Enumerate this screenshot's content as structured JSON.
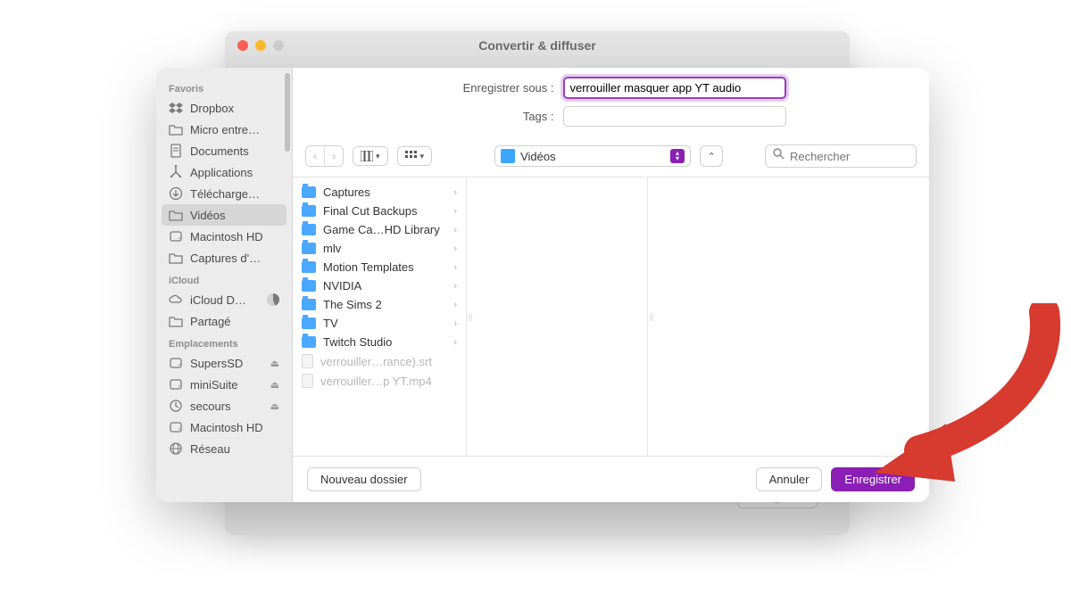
{
  "backdrop": {
    "title": "Convertir & diffuser",
    "button": "Enregistrer"
  },
  "form": {
    "save_as_label": "Enregistrer sous :",
    "save_as_value": "verrouiller masquer app YT audio",
    "tags_label": "Tags :"
  },
  "location": {
    "name": "Vidéos"
  },
  "search": {
    "placeholder": "Rechercher"
  },
  "sidebar": {
    "section_favoris": "Favoris",
    "section_icloud": "iCloud",
    "section_emplacements": "Emplacements",
    "favoris": [
      {
        "label": "Dropbox",
        "icon": "dropbox"
      },
      {
        "label": "Micro entre…",
        "icon": "folder"
      },
      {
        "label": "Documents",
        "icon": "doc"
      },
      {
        "label": "Applications",
        "icon": "apps"
      },
      {
        "label": "Télécharge…",
        "icon": "download"
      },
      {
        "label": "Vidéos",
        "icon": "folder",
        "selected": true
      },
      {
        "label": "Macintosh HD",
        "icon": "disk"
      },
      {
        "label": "Captures d'…",
        "icon": "folder"
      }
    ],
    "icloud": [
      {
        "label": "iCloud D…",
        "icon": "cloud",
        "pie": true
      },
      {
        "label": "Partagé",
        "icon": "folder"
      }
    ],
    "emplacements": [
      {
        "label": "SupersSD",
        "icon": "disk",
        "eject": true
      },
      {
        "label": "miniSuite",
        "icon": "disk",
        "eject": true
      },
      {
        "label": "secours",
        "icon": "time",
        "eject": true
      },
      {
        "label": "Macintosh HD",
        "icon": "disk"
      },
      {
        "label": "Réseau",
        "icon": "globe"
      }
    ]
  },
  "column": [
    {
      "label": "Captures",
      "type": "folder"
    },
    {
      "label": "Final Cut Backups",
      "type": "folder"
    },
    {
      "label": "Game Ca…HD Library",
      "type": "folder"
    },
    {
      "label": "mlv",
      "type": "folder"
    },
    {
      "label": "Motion Templates",
      "type": "folder"
    },
    {
      "label": "NVIDIA",
      "type": "folder"
    },
    {
      "label": "The Sims 2",
      "type": "folder"
    },
    {
      "label": "TV",
      "type": "folder"
    },
    {
      "label": "Twitch Studio",
      "type": "folder"
    },
    {
      "label": "verrouiller…rance).srt",
      "type": "file",
      "dim": true
    },
    {
      "label": "verrouiller…p YT.mp4",
      "type": "file",
      "dim": true
    }
  ],
  "footer": {
    "new_folder": "Nouveau dossier",
    "cancel": "Annuler",
    "save": "Enregistrer"
  }
}
